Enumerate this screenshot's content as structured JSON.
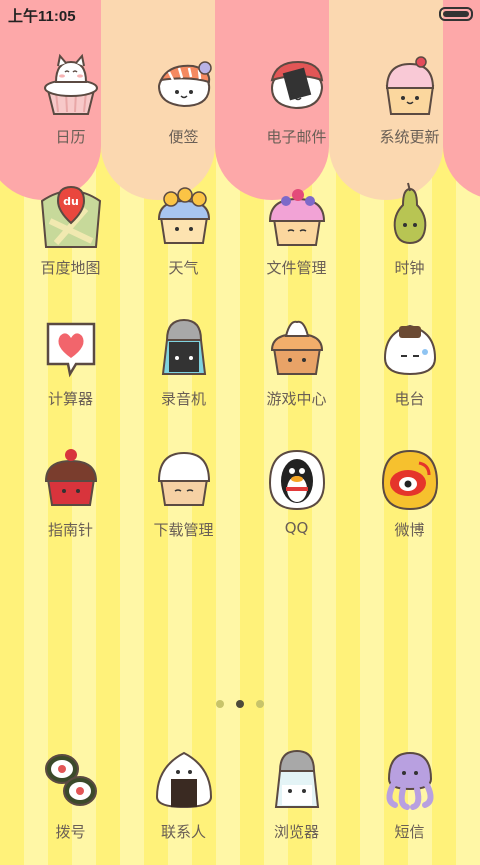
{
  "status_bar": {
    "time": "上午11:05"
  },
  "apps": [
    {
      "label": "日历",
      "icon": "cat-cupcake-icon"
    },
    {
      "label": "便签",
      "icon": "shrimp-sushi-icon"
    },
    {
      "label": "电子邮件",
      "icon": "salmon-sushi-icon"
    },
    {
      "label": "系统更新",
      "icon": "strawberry-cupcake-icon"
    },
    {
      "label": "百度地图",
      "icon": "map-cupcake-icon"
    },
    {
      "label": "天气",
      "icon": "lemon-cupcake-icon"
    },
    {
      "label": "文件管理",
      "icon": "berry-cupcake-icon"
    },
    {
      "label": "时钟",
      "icon": "pear-icon"
    },
    {
      "label": "计算器",
      "icon": "heart-card-icon"
    },
    {
      "label": "录音机",
      "icon": "pepper-shaker-icon"
    },
    {
      "label": "游戏中心",
      "icon": "cream-cupcake-icon"
    },
    {
      "label": "电台",
      "icon": "onigiri-icon"
    },
    {
      "label": "指南针",
      "icon": "cherry-cake-icon"
    },
    {
      "label": "下载管理",
      "icon": "vanilla-cupcake-icon"
    },
    {
      "label": "QQ",
      "icon": "penguin-icon"
    },
    {
      "label": "微博",
      "icon": "weibo-icon"
    }
  ],
  "dock": [
    {
      "label": "拨号",
      "icon": "sushi-roll-icon"
    },
    {
      "label": "联系人",
      "icon": "onigiri-nori-icon"
    },
    {
      "label": "浏览器",
      "icon": "salt-shaker-icon"
    },
    {
      "label": "短信",
      "icon": "octopus-icon"
    }
  ],
  "page_indicator": {
    "count": 3,
    "active": 2
  }
}
